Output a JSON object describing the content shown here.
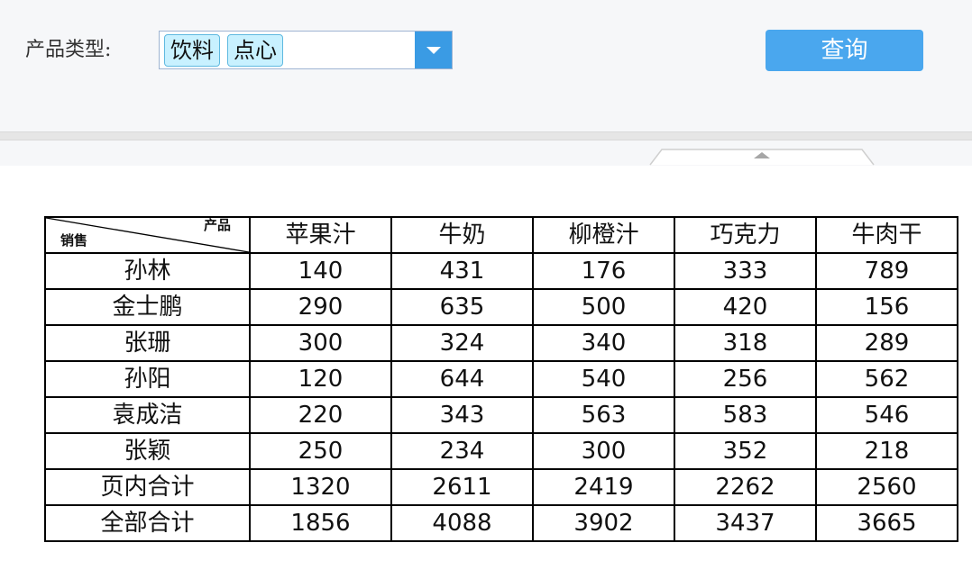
{
  "filter": {
    "label": "产品类型:",
    "selected_tags": [
      "饮料",
      "点心"
    ],
    "query_button": "查询"
  },
  "colors": {
    "tag_bg": "#c8f1ff",
    "tag_border": "#5fb9e0",
    "dropdown_arrow_bg": "#3a9be4",
    "query_button_bg": "#4aa7ee"
  },
  "icons": {
    "dropdown": "chevron-down-icon",
    "collapse": "collapse-up-icon"
  },
  "table": {
    "corner_top": "产品",
    "corner_bottom": "销售",
    "columns": [
      "苹果汁",
      "牛奶",
      "柳橙汁",
      "巧克力",
      "牛肉干"
    ],
    "rows": [
      {
        "name": "孙林",
        "values": [
          "140",
          "431",
          "176",
          "333",
          "789"
        ]
      },
      {
        "name": "金士鹏",
        "values": [
          "290",
          "635",
          "500",
          "420",
          "156"
        ]
      },
      {
        "name": "张珊",
        "values": [
          "300",
          "324",
          "340",
          "318",
          "289"
        ]
      },
      {
        "name": "孙阳",
        "values": [
          "120",
          "644",
          "540",
          "256",
          "562"
        ]
      },
      {
        "name": "袁成洁",
        "values": [
          "220",
          "343",
          "563",
          "583",
          "546"
        ]
      },
      {
        "name": "张颖",
        "values": [
          "250",
          "234",
          "300",
          "352",
          "218"
        ]
      }
    ],
    "page_total": {
      "name": "页内合计",
      "values": [
        "1320",
        "2611",
        "2419",
        "2262",
        "2560"
      ]
    },
    "grand_total": {
      "name": "全部合计",
      "values": [
        "1856",
        "4088",
        "3902",
        "3437",
        "3665"
      ]
    }
  }
}
